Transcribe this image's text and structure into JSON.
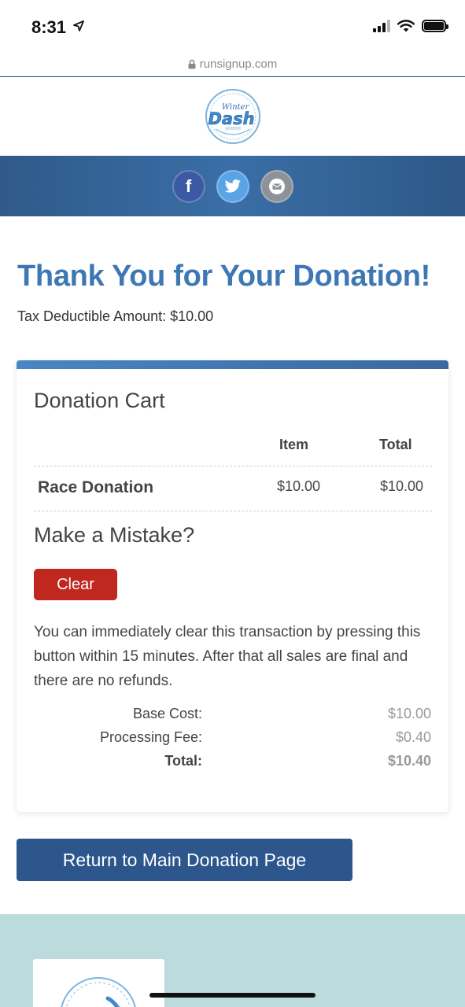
{
  "status_bar": {
    "time": "8:31"
  },
  "browser": {
    "url": "runsignup.com"
  },
  "header": {
    "logo_alt_words": [
      "Winter",
      "Dash"
    ]
  },
  "share": {
    "facebook_letter": "f"
  },
  "main": {
    "title": "Thank You for Your Donation!",
    "tax_line": "Tax Deductible Amount: $10.00"
  },
  "cart": {
    "title": "Donation Cart",
    "columns": {
      "item": "Item",
      "total": "Total"
    },
    "row": {
      "name": "Race Donation",
      "item": "$10.00",
      "total": "$10.00"
    },
    "mistake_title": "Make a Mistake?",
    "clear_label": "Clear",
    "clear_note": "You can immediately clear this transaction by pressing this button within 15 minutes. After that all sales are final and there are no refunds.",
    "summary": {
      "base_label": "Base Cost:",
      "base_value": "$10.00",
      "fee_label": "Processing Fee:",
      "fee_value": "$0.40",
      "total_label": "Total:",
      "total_value": "$10.40"
    }
  },
  "actions": {
    "return_label": "Return to Main Donation Page"
  },
  "colors": {
    "title_blue": "#3e78b4",
    "band_blue": "#2f5a8a",
    "clear_red": "#c0281f",
    "button_navy": "#2c568c",
    "footer_teal": "#bcdbdc"
  },
  "icons": [
    "location-arrow-icon",
    "signal-icon",
    "wifi-icon",
    "battery-icon",
    "lock-icon",
    "facebook-icon",
    "twitter-icon",
    "email-icon"
  ]
}
